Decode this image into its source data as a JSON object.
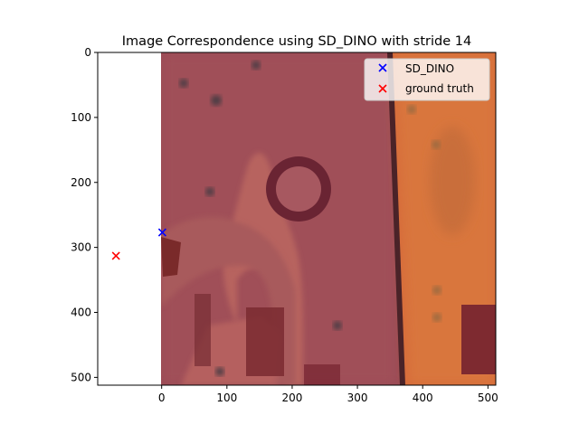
{
  "chart_data": {
    "type": "scatter",
    "title": "Image Correspondence using SD_DINO with  stride 14",
    "xlabel": "",
    "ylabel": "",
    "xlim": [
      -98,
      512
    ],
    "ylim": [
      512,
      0
    ],
    "x_ticks": [
      0,
      100,
      200,
      300,
      400,
      500
    ],
    "y_ticks": [
      0,
      100,
      200,
      300,
      400,
      500
    ],
    "background_image": {
      "x_range": [
        0,
        512
      ],
      "y_range": [
        0,
        512
      ]
    },
    "grid": false,
    "legend": "top-right",
    "series": [
      {
        "name": "SD_DINO",
        "marker": "x",
        "color": "#0000ff",
        "points": [
          [
            1,
            277
          ]
        ]
      },
      {
        "name": "ground truth",
        "marker": "x",
        "color": "#ff0000",
        "points": [
          [
            -70,
            313
          ]
        ]
      }
    ]
  }
}
